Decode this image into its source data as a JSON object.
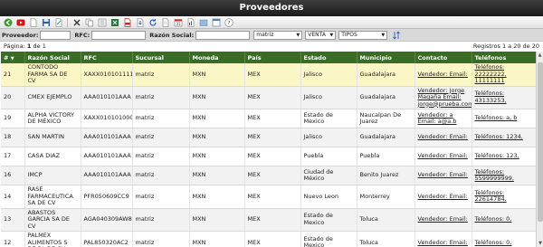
{
  "window": {
    "title": "Proveedores"
  },
  "filters": {
    "proveedor_label": "Proveedor:",
    "rfc_label": "RFC:",
    "razon_label": "Razón Social:",
    "sucursal_value": "matriz",
    "tipo_value": "VENTA",
    "tipos_value": "TIPOS"
  },
  "paging": {
    "prefix": "Página:",
    "page": "1",
    "suffix": "de 1",
    "records": "Registros 1 a 20 de 20"
  },
  "columns": [
    "#",
    "Razón Social",
    "RFC",
    "Sucursal",
    "Moneda",
    "País",
    "Estado",
    "Municipio",
    "Contacto",
    "Teléfonos"
  ],
  "rows": [
    {
      "n": "21",
      "razon": "CONTODO FARMA SA DE CV",
      "rfc": "XAXX010101111",
      "suc": "matriz",
      "mon": "MXN",
      "pais": "MEX",
      "estado": "Jalisco",
      "mun": "Guadalajara",
      "contacto": "Vendedor: Email:",
      "tel": "Teléfonos: 22222222, 11111111"
    },
    {
      "n": "20",
      "razon": "CMEX EJEMPLO",
      "rfc": "AAA010101AAA",
      "suc": "matriz",
      "mon": "MXN",
      "pais": "MEX",
      "estado": "Jalisco",
      "mun": "Guadalajara",
      "contacto": "Vendedor: Jorge Magaña Email: jorge@prueba.com",
      "tel": "Teléfonos: 43133253,"
    },
    {
      "n": "19",
      "razon": "ALPHA VICTORY DE MÉXICO",
      "rfc": "XAXX010101000",
      "suc": "matriz",
      "mon": "MXN",
      "pais": "MEX",
      "estado": "Estado de Mexico",
      "mun": "Naucalpan De Juarez",
      "contacto": "Vendedor: a Email: a@a.b",
      "tel": "Teléfonos: a, b"
    },
    {
      "n": "18",
      "razon": "SAN MARTIN",
      "rfc": "AAA010101AAA",
      "suc": "matriz",
      "mon": "MXN",
      "pais": "MEX",
      "estado": "Jalisco",
      "mun": "Guadalajara",
      "contacto": "Vendedor: Email:",
      "tel": "Teléfonos: 1234,"
    },
    {
      "n": "17",
      "razon": "CASA DIAZ",
      "rfc": "AAA010101AAA",
      "suc": "matriz",
      "mon": "MXN",
      "pais": "MEX",
      "estado": "Puebla",
      "mun": "Puebla",
      "contacto": "Vendedor: Email:",
      "tel": "Teléfonos: 123,"
    },
    {
      "n": "16",
      "razon": "IMCP",
      "rfc": "AAA010101AAA",
      "suc": "matriz",
      "mon": "MXN",
      "pais": "MEX",
      "estado": "Ciudad de México",
      "mun": "Benito Juarez",
      "contacto": "Vendedor: Email:",
      "tel": "Teléfonos: 5599999999,"
    },
    {
      "n": "14",
      "razon": "RASE FARMACEUTICA SA DE CV",
      "rfc": "PFR050609CC9",
      "suc": "matriz",
      "mon": "MXN",
      "pais": "MEX",
      "estado": "Nuevo Leon",
      "mun": "Monterrey",
      "contacto": "Vendedor: Email:",
      "tel": "Teléfonos: 22614784,"
    },
    {
      "n": "13",
      "razon": "ABASTOS GARCIA SA DE CV",
      "rfc": "AGA040309AW8",
      "suc": "matriz",
      "mon": "MXN",
      "pais": "MEX",
      "estado": "Estado de Mexico",
      "mun": "Toluca",
      "contacto": "Vendedor: Email:",
      "tel": "Teléfonos: 0,"
    },
    {
      "n": "12",
      "razon": "PALMEX ALIMENTOS S DE RL DE CV",
      "rfc": "PAL850320AC2",
      "suc": "matriz",
      "mon": "MXN",
      "pais": "MEX",
      "estado": "Estado de Mexico",
      "mun": "Toluca",
      "contacto": "Vendedor: Email:",
      "tel": "Teléfonos: 0,"
    }
  ]
}
